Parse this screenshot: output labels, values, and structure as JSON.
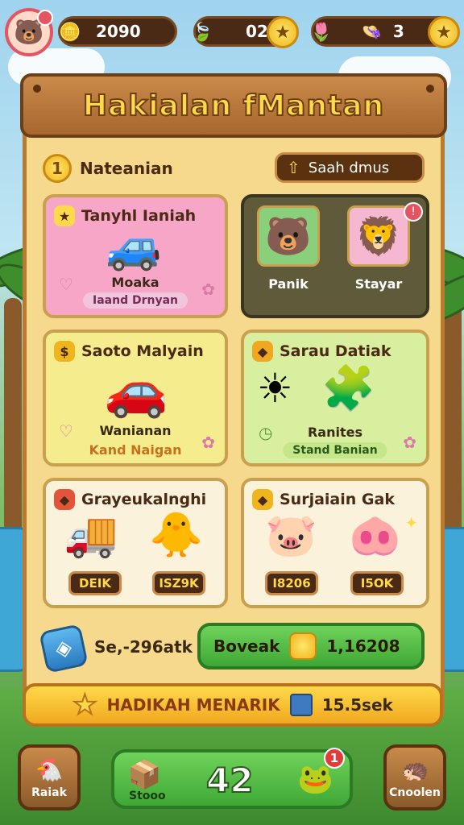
{
  "hud": {
    "coins": "2090",
    "leaves": "02",
    "flowers": "3"
  },
  "board": {
    "title": "Hakialan fMantan",
    "category_number": "1",
    "category_label": "Nateanian",
    "search_label": "Saah dmus"
  },
  "cards": {
    "c1": {
      "title": "Tanyhl Ianiah",
      "caption": "Moaka",
      "sub": "Iaand Drnyan"
    },
    "c2": {
      "left_caption": "Panik",
      "right_caption": "Stayar",
      "badge": "!"
    },
    "c3": {
      "title": "Saoto Malyain",
      "caption": "Wanianan",
      "sub": "Kand Naigan"
    },
    "c4": {
      "title": "Sarau Datiak",
      "caption": "Ranites",
      "sub": "Stand Banian"
    },
    "c5": {
      "title": "Grayeukalnghi",
      "price_left": "DEIK",
      "price_right": "ISZ9K"
    },
    "c6": {
      "title": "Surjaiain Gak",
      "price_left": "I8206",
      "price_right": "I5OK"
    }
  },
  "bottom": {
    "gem_count": "Se,-296atk",
    "green_label": "Boveak",
    "green_value": "1,16208"
  },
  "banner": {
    "text": "HADIKAH MENARIK",
    "timer": "15.5sek"
  },
  "nav": {
    "left_label": "Raiak",
    "center_label": "Stooo",
    "center_value": "42",
    "center_notif": "1",
    "right_label": "Cnoolen"
  },
  "colors": {
    "pink_card": "#f7a6c8",
    "yellow_card": "#f5ec8e",
    "green_card": "#d8efa0",
    "cream_card": "#fbf2dc",
    "dark_card": "#5f5a3a",
    "accent_green": "#3fa835"
  }
}
